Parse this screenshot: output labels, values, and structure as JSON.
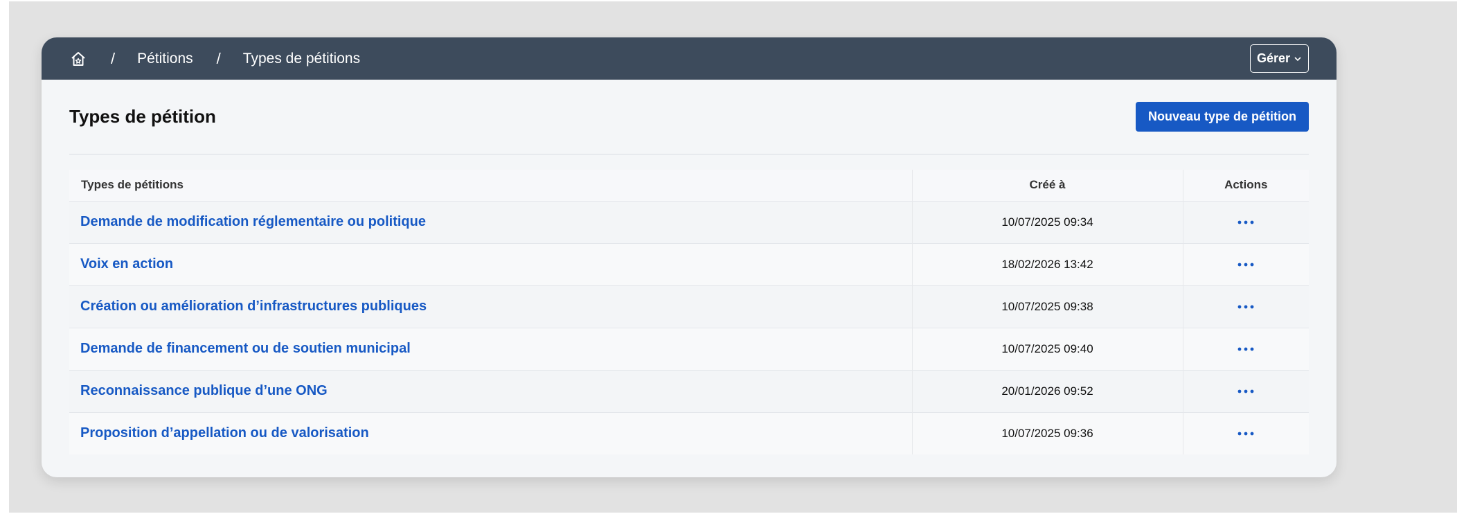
{
  "breadcrumb": {
    "home_icon": "home-icon",
    "items": [
      "Pétitions",
      "Types de pétitions"
    ],
    "separator": "/"
  },
  "topbar": {
    "manage_label": "Gérer",
    "manage_icon": "chevron-down-icon"
  },
  "page": {
    "title": "Types de pétition",
    "new_button_label": "Nouveau type de pétition"
  },
  "table": {
    "columns": [
      "Types de pétitions",
      "Créé à",
      "Actions"
    ],
    "rows": [
      {
        "name": "Demande de modification réglementaire ou politique",
        "created": "10/07/2025 09:34"
      },
      {
        "name": "Voix en action",
        "created": "18/02/2026 13:42"
      },
      {
        "name": "Création ou amélioration d’infrastructures publiques",
        "created": "10/07/2025 09:38"
      },
      {
        "name": "Demande de financement ou de soutien municipal",
        "created": "10/07/2025 09:40"
      },
      {
        "name": "Reconnaissance publique d’une ONG",
        "created": "20/01/2026 09:52"
      },
      {
        "name": "Proposition d’appellation ou de valorisation",
        "created": "10/07/2025 09:36"
      }
    ],
    "actions_icon": "more-horizontal-icon"
  },
  "colors": {
    "topbar": "#3d4b5c",
    "accent": "#1759c4",
    "card": "#f4f6f8",
    "backdrop": "#e2e2e2"
  }
}
